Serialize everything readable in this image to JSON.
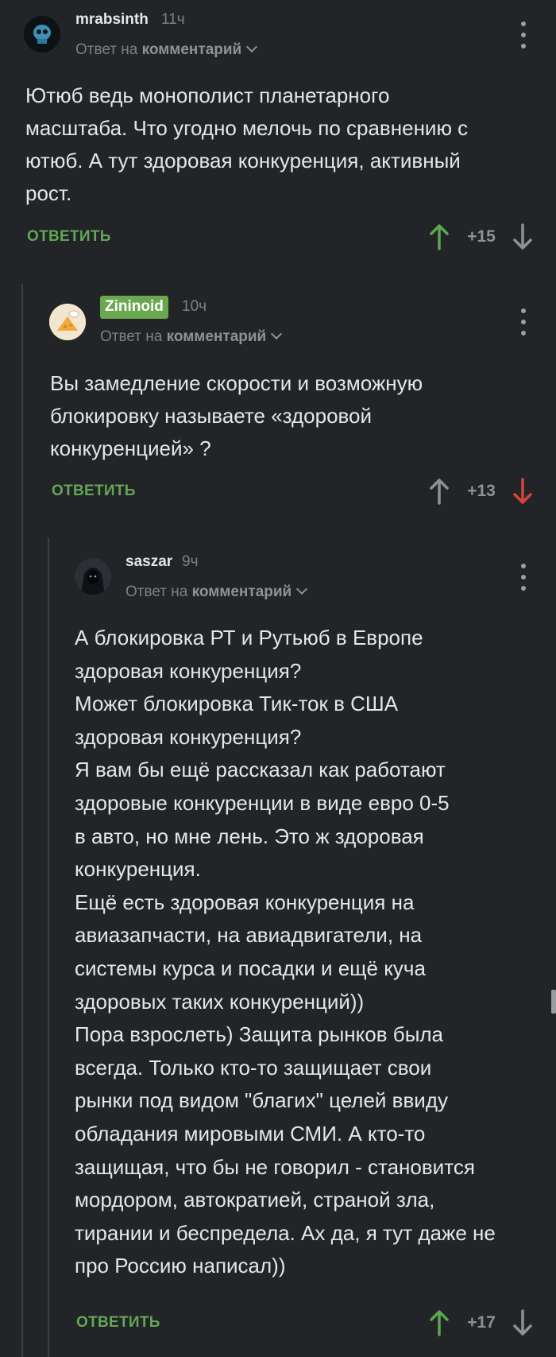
{
  "comments": [
    {
      "author": "mrabsinth",
      "time": "11ч",
      "reply_prefix": "Ответ на",
      "reply_target": "комментарий",
      "text": "Ютюб ведь монополист планетарного\nмасштаба. Что угодно мелочь по сравнению с\nютюб. А тут здоровая конкуренция, активный\nрост.",
      "reply_label": "ОТВЕТИТЬ",
      "score": "+15",
      "vote": "up"
    },
    {
      "author": "Zininoid",
      "time": "10ч",
      "reply_prefix": "Ответ на",
      "reply_target": "комментарий",
      "text": "Вы замедление скорости и возможную\nблокировку называете «здоровой\nконкуренцией» ?",
      "reply_label": "ОТВЕТИТЬ",
      "score": "+13",
      "vote": "down"
    },
    {
      "author": "saszar",
      "time": "9ч",
      "reply_prefix": "Ответ на",
      "reply_target": "комментарий",
      "text": "А блокировка РТ и Рутьюб в Европе\nздоровая конкуренция?\nМожет блокировка Тик-ток в США\nздоровая конкуренция?\nЯ вам бы ещё рассказал как работают\nздоровые конкуренции в виде евро 0-5\nв авто, но мне лень. Это ж здоровая\nконкуренция.\nЕщё есть здоровая конкуренция на\nавиазапчасти, на авиадвигатели, на\nсистемы курса и посадки и ещё куча\nздоровых таких конкуренций))\nПора взрослеть) Защита рынков была\nвсегда. Только кто-то защищает свои\nрынки под видом \"благих\" целей ввиду\nобладания мировыми СМИ. А кто-то\nзащищая, что бы не говорил - становится\nмордором, автократией, страной зла,\nтирании и беспредела. Ах да, я тут даже не\nпро Россию написал))",
      "reply_label": "ОТВЕТИТЬ",
      "score": "+17",
      "vote": "none"
    }
  ],
  "colors": {
    "background": "#222427",
    "accent_green": "#64a657",
    "badge_green": "#6aa84f",
    "upvote_active": "#5da84e",
    "downvote_active": "#d9443a",
    "vote_neutral": "#8e9297"
  }
}
